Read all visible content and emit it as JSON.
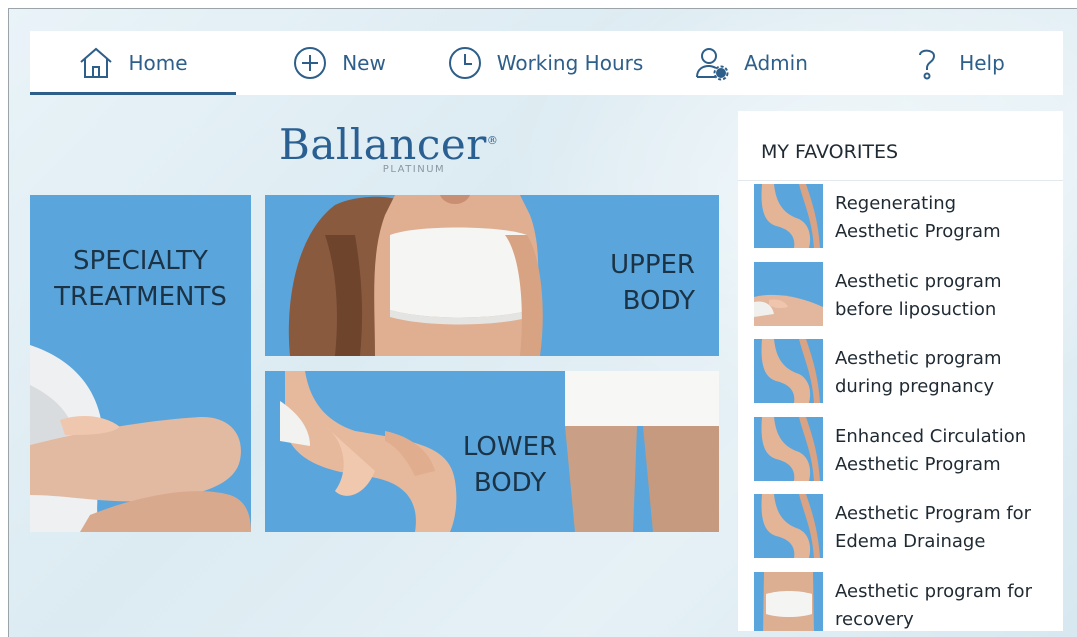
{
  "nav": {
    "items": [
      {
        "label": "Home",
        "icon": "home-icon",
        "active": true
      },
      {
        "label": "New",
        "icon": "plus-circle-icon",
        "active": false
      },
      {
        "label": "Working Hours",
        "icon": "clock-icon",
        "active": false
      },
      {
        "label": "Admin",
        "icon": "user-gear-icon",
        "active": false
      },
      {
        "label": "Help",
        "icon": "question-icon",
        "active": false
      }
    ]
  },
  "logo": {
    "main": "Ballancer",
    "reg": "®",
    "sub": "PLATINUM"
  },
  "tiles": {
    "specialty": {
      "line1": "SPECIALTY",
      "line2": "TREATMENTS"
    },
    "upper": {
      "line1": "UPPER",
      "line2": "BODY"
    },
    "lower": {
      "line1": "LOWER",
      "line2": "BODY"
    }
  },
  "favorites": {
    "title": "MY FAVORITES",
    "items": [
      {
        "line1": "Regenerating",
        "line2": "Aesthetic Program"
      },
      {
        "line1": "Aesthetic program",
        "line2": "before liposuction"
      },
      {
        "line1": "Aesthetic program",
        "line2": "during pregnancy"
      },
      {
        "line1": "Enhanced Circulation",
        "line2": "Aesthetic Program"
      },
      {
        "line1": "Aesthetic Program for",
        "line2": "Edema Drainage"
      },
      {
        "line1": "Aesthetic program for",
        "line2": "recovery"
      }
    ]
  },
  "colors": {
    "accent": "#2d5f8a",
    "tile_blue": "#5aa6dc",
    "logo_blue": "#2a5f92"
  }
}
